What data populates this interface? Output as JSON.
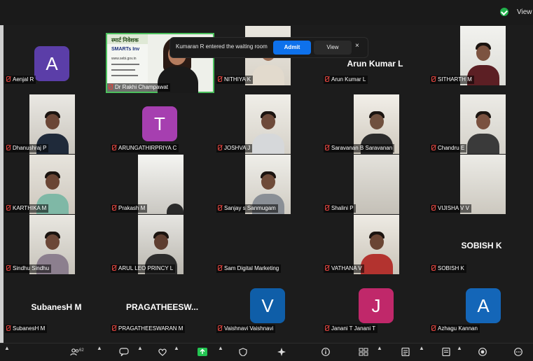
{
  "topbar": {
    "view_label": "View"
  },
  "notification": {
    "message": "Kumaran R entered the waiting room",
    "admit_label": "Admit",
    "view_label": "View",
    "close_label": "×"
  },
  "tiles": {
    "aenjal": {
      "name": "Aenjal R",
      "avatar_letter": "A"
    },
    "rakhi": {
      "name": "Dr Rakhi Champawat",
      "slide_line1": "स्मार्ट निवेशक",
      "slide_line2": "SMARTs Inv",
      "slide_line3": "www.sebi.gov.in"
    },
    "nithiya": {
      "name": "NITHIYA K"
    },
    "arun": {
      "name": "Arun Kumar L",
      "display": "Arun Kumar L"
    },
    "sitharth": {
      "name": "SITHARTH M"
    },
    "dhanush": {
      "name": "Dhanushraj P"
    },
    "arungathir": {
      "name": "ARUNGATHIRPRIYA C",
      "avatar_letter": "T"
    },
    "joshva": {
      "name": "JOSHVA J"
    },
    "saravanan": {
      "name": "Saravanan B Saravanan"
    },
    "chandru": {
      "name": "Chandru E"
    },
    "karthika": {
      "name": "KARTHIKA M"
    },
    "prakash": {
      "name": "Prakash M"
    },
    "sanjay": {
      "name": "Sanjay s Sanmugam"
    },
    "shalini": {
      "name": "Shalini P"
    },
    "vijisha": {
      "name": "VIJISHA V V"
    },
    "sindhu": {
      "name": "Sindhu Sindhu"
    },
    "arulleo": {
      "name": "ARUL LEO PRINCY L"
    },
    "samdigital": {
      "name": "Sam Digital Marketing"
    },
    "vathana": {
      "name": "VATHANA V"
    },
    "sobish": {
      "name": "SOBISH K",
      "display": "SOBISH K"
    },
    "subanesh": {
      "name": "SubanesH M",
      "display": "SubanesH M"
    },
    "pragatheeswaran": {
      "name": "PRAGATHEESWARAN M",
      "display": "PRAGATHEESW..."
    },
    "vaishnavi": {
      "name": "Vaishnavi Vaishnavi",
      "avatar_letter": "V"
    },
    "janani": {
      "name": "Janani T Janani T",
      "avatar_letter": "J"
    },
    "azhagu": {
      "name": "Azhagu Kannan",
      "avatar_letter": "A"
    }
  },
  "toolbar": {
    "participants_count": "62"
  },
  "colors": {
    "avatar_purple": "#5b3ea8",
    "avatar_magenta": "#a63fb0",
    "avatar_blue": "#0f5ea8",
    "avatar_pink": "#c0286a",
    "avatar_blue2": "#1466b8",
    "admit_blue": "#0e71eb",
    "active_green": "#4cc05d",
    "muted_red": "#e0443e"
  },
  "icons": [
    "shield-check-icon",
    "participants-icon",
    "chat-icon",
    "reactions-icon",
    "share-screen-icon",
    "security-icon",
    "ai-sparkle-icon",
    "info-icon",
    "apps-icon",
    "notes-icon",
    "docs-icon",
    "record-icon",
    "more-icon",
    "caret-up-icon",
    "mic-muted-icon"
  ]
}
